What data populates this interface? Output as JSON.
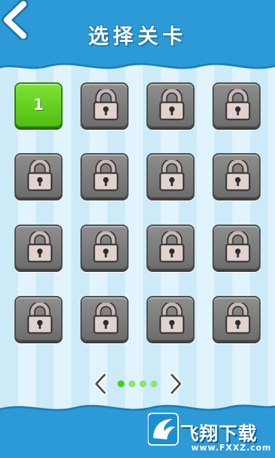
{
  "header": {
    "title": "选择关卡"
  },
  "levels": [
    {
      "number": "1",
      "state": "unlocked"
    },
    {
      "number": "",
      "state": "locked"
    },
    {
      "number": "",
      "state": "locked"
    },
    {
      "number": "",
      "state": "locked"
    },
    {
      "number": "",
      "state": "locked"
    },
    {
      "number": "",
      "state": "locked"
    },
    {
      "number": "",
      "state": "locked"
    },
    {
      "number": "",
      "state": "locked"
    },
    {
      "number": "",
      "state": "locked"
    },
    {
      "number": "",
      "state": "locked"
    },
    {
      "number": "",
      "state": "locked"
    },
    {
      "number": "",
      "state": "locked"
    },
    {
      "number": "",
      "state": "locked"
    },
    {
      "number": "",
      "state": "locked"
    },
    {
      "number": "",
      "state": "locked"
    },
    {
      "number": "",
      "state": "locked"
    }
  ],
  "pagination": {
    "page_count": 4,
    "current_page": 1
  },
  "watermark": {
    "brand": "飞翔下载",
    "url": "www.FXXZ.com"
  },
  "colors": {
    "header_blue": "#2c9ad6",
    "unlocked_green": "#5ccb1b",
    "locked_gray": "#7d7d7d"
  }
}
